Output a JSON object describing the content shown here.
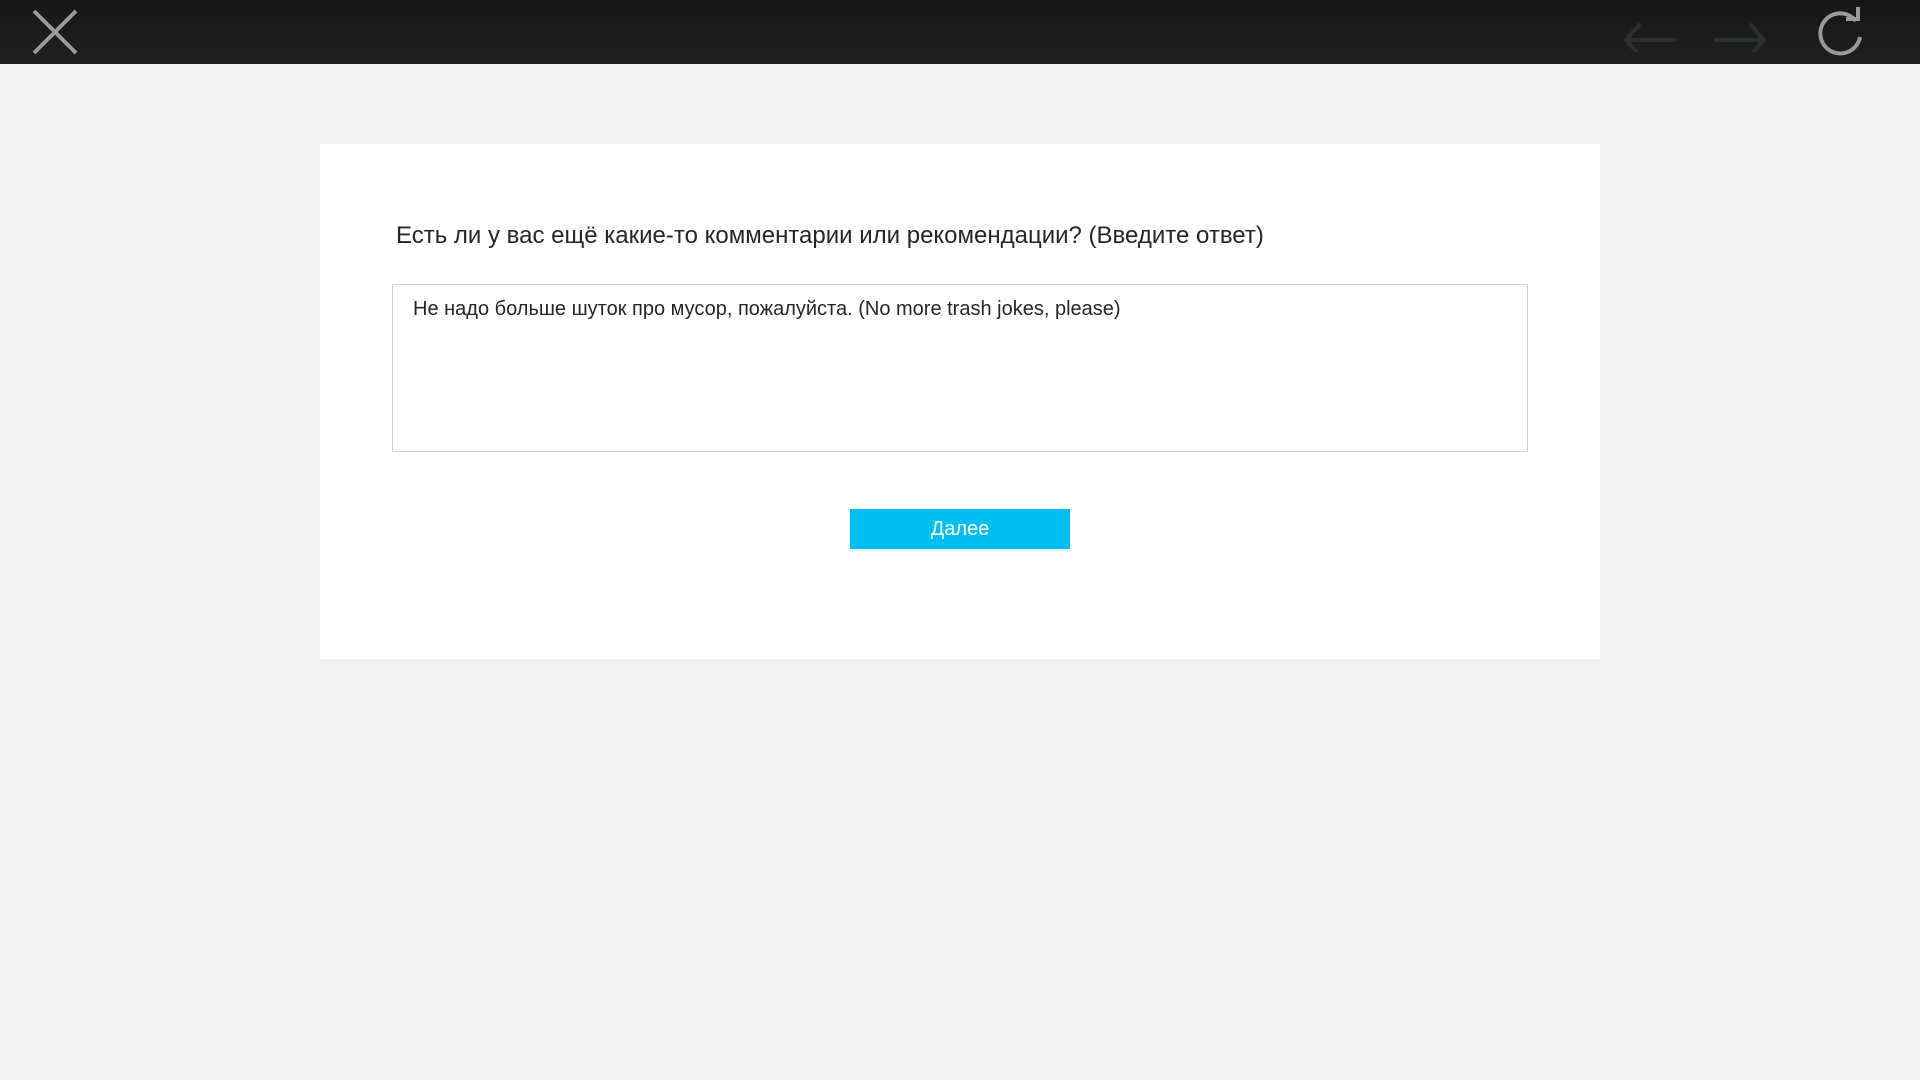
{
  "toolbar": {
    "close_icon": "close-icon",
    "back_icon": "arrow-left-icon",
    "forward_icon": "arrow-right-icon",
    "refresh_icon": "refresh-icon"
  },
  "survey": {
    "question": "Есть ли у вас ещё какие-то комментарии или рекомендации?  (Введите ответ)",
    "answer_value": "Не надо больше шуток про мусор, пожалуйста. (No more trash jokes, please)",
    "next_label": "Далее"
  },
  "colors": {
    "topbar": "#1c1d1e",
    "background": "#f1f1f1",
    "card": "#ffffff",
    "accent": "#00c0f3"
  }
}
